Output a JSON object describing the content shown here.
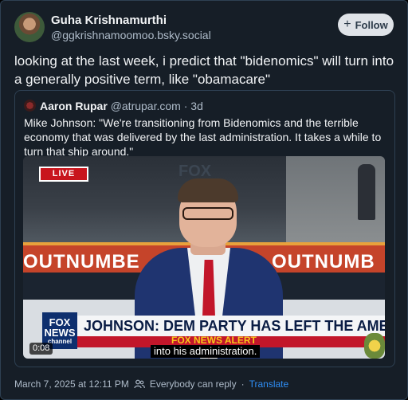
{
  "post": {
    "author_name": "Guha Krishnamurthi",
    "author_handle": "@ggkrishnamoomoo.bsky.social",
    "follow_label": "Follow",
    "text": "looking at the last week, i predict that \"bidenomics\" will turn into a generally positive term, like \"obamacare\""
  },
  "quote": {
    "author_name": "Aaron Rupar",
    "author_handle": "@atrupar.com",
    "separator": "·",
    "age": "3d",
    "text": "Mike Johnson: \"We're transitioning from Bidenomics and the terrible economy that was delivered by the last administration. It takes a while to turn that ship around.\""
  },
  "video": {
    "live_badge": "LIVE",
    "wall_text": "FOX",
    "band_left": "OUTNUMBE",
    "band_right": "OUTNUMB",
    "fox_logo_top": "FOX",
    "fox_logo_bottom": "NEWS",
    "fox_logo_sub": "channel",
    "chyron": "JOHNSON: DEM PARTY HAS LEFT THE AMERICAN PEOPLE",
    "alert": "FOX NEWS ALERT",
    "timestamp": "0:08",
    "caption": "into his administration."
  },
  "footer": {
    "datetime": "March 7, 2025 at 12:11 PM",
    "reply_setting": "Everybody can reply",
    "dot": "·",
    "translate": "Translate"
  },
  "colors": {
    "background": "#161e27",
    "border": "#2e4052",
    "link": "#2f8ef5",
    "follow_bg": "#dfe3e8"
  },
  "icons": [
    "plus-icon",
    "people-icon"
  ]
}
